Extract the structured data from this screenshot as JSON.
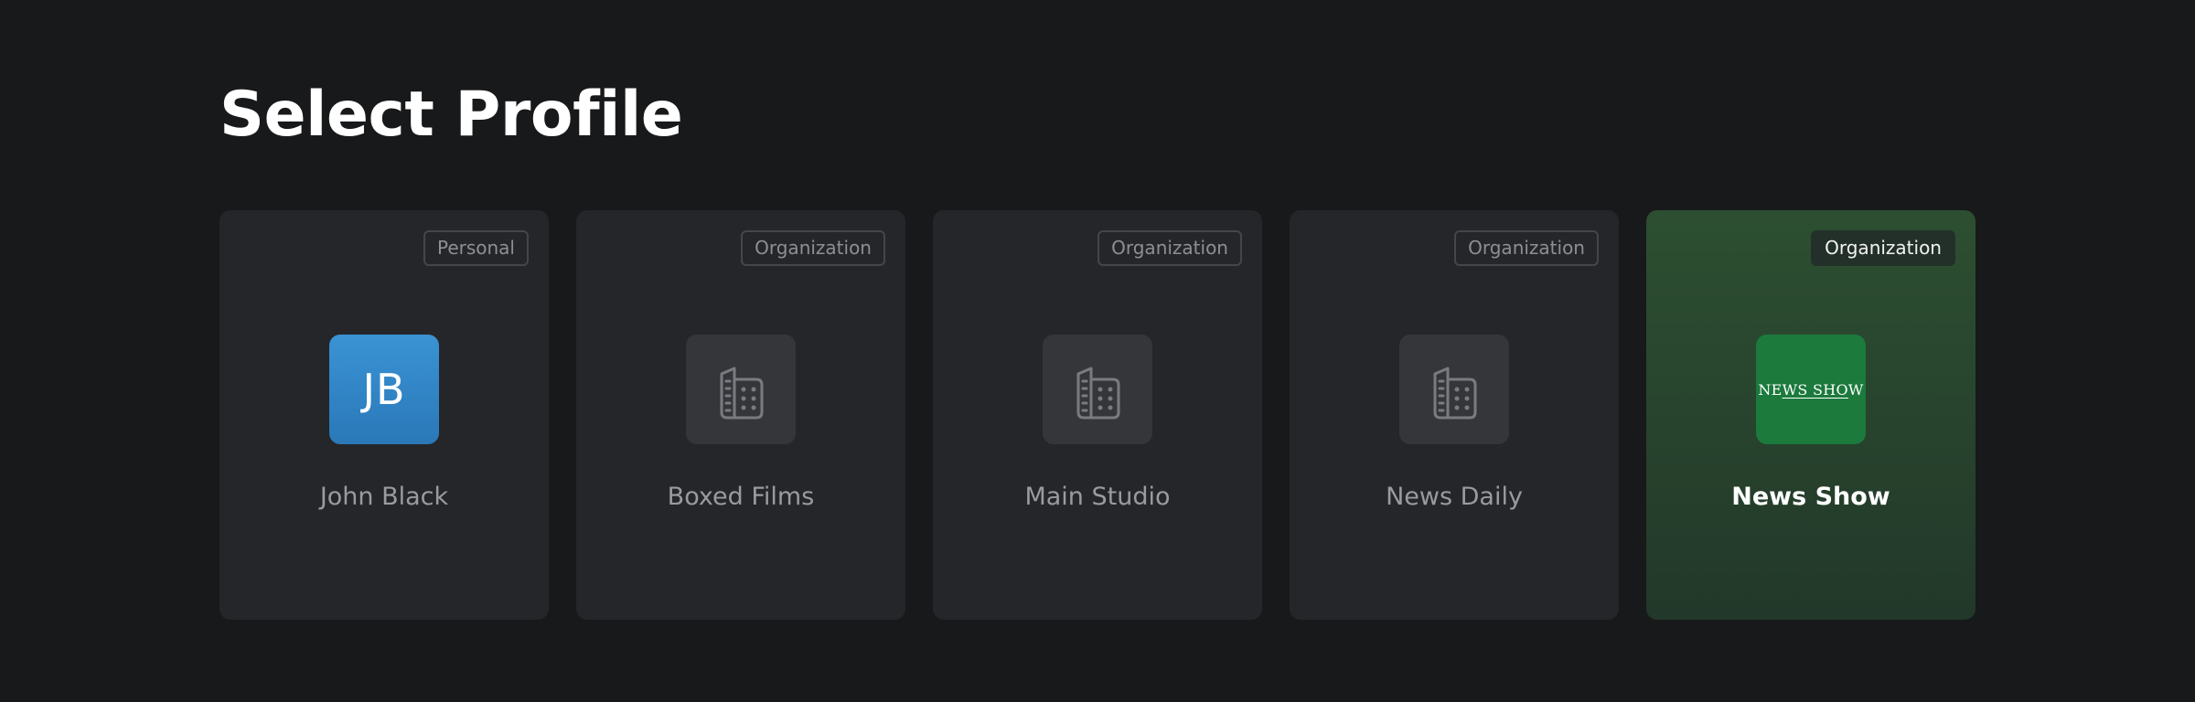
{
  "page": {
    "title": "Select Profile"
  },
  "profiles": [
    {
      "name": "John Black",
      "badge": "Personal",
      "avatar_type": "initials",
      "initials": "JB",
      "avatar_color": "#2f86c6",
      "selected": false
    },
    {
      "name": "Boxed Films",
      "badge": "Organization",
      "avatar_type": "org",
      "icon": "building-icon",
      "selected": false
    },
    {
      "name": "Main Studio",
      "badge": "Organization",
      "avatar_type": "org",
      "icon": "building-icon",
      "selected": false
    },
    {
      "name": "News Daily",
      "badge": "Organization",
      "avatar_type": "org",
      "icon": "building-icon",
      "selected": false
    },
    {
      "name": "News Show",
      "badge": "Organization",
      "avatar_type": "logo",
      "logo_text_1": "NE",
      "logo_text_2": "WS SHO",
      "logo_text_3": "W",
      "avatar_color": "#1c7a3c",
      "selected": true
    }
  ],
  "colors": {
    "background": "#18191b",
    "card": "#252629",
    "selected_card": "#2d4f31",
    "accent_blue": "#2f86c6",
    "accent_green": "#1c7a3c"
  }
}
